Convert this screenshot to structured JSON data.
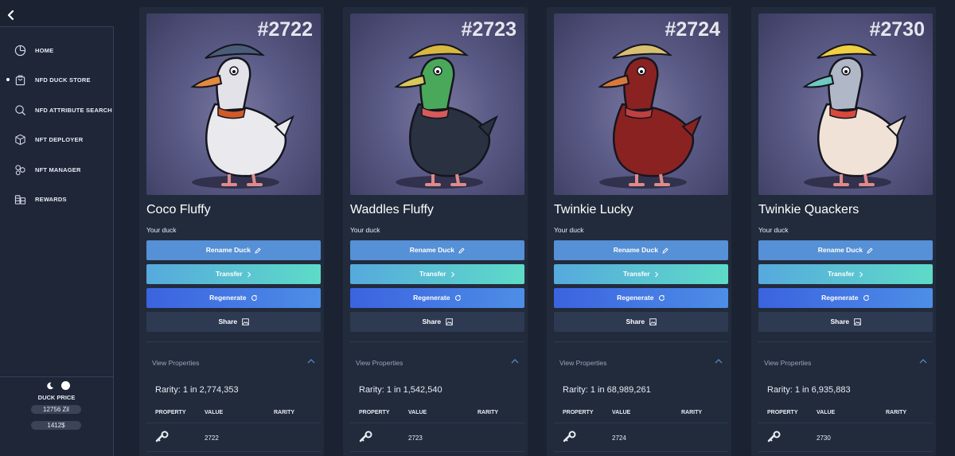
{
  "sidebar": {
    "nav": [
      {
        "label": "HOME",
        "icon": "pie-chart-icon",
        "active": false
      },
      {
        "label": "NFD DUCK STORE",
        "icon": "shopping-bag-icon",
        "active": true
      },
      {
        "label": "NFD ATTRIBUTE SEARCH",
        "icon": "search-icon",
        "active": false
      },
      {
        "label": "NFT DEPLOYER",
        "icon": "cube-icon",
        "active": false
      },
      {
        "label": "NFT MANAGER",
        "icon": "nodes-icon",
        "active": false
      },
      {
        "label": "REWARDS",
        "icon": "coins-icon",
        "active": false
      }
    ],
    "duck_price_title": "DUCK PRICE",
    "price_zil": "12756 Zil",
    "price_usd": "1412$"
  },
  "cards": [
    {
      "number": "#2722",
      "name": "Coco Fluffy",
      "subtitle": "Your duck",
      "rename": "Rename Duck",
      "transfer": "Transfer",
      "regenerate": "Regenerate",
      "share": "Share",
      "view_properties": "View Properties",
      "rarity": "Rarity: 1 in 2,774,353",
      "headers": [
        "PROPERTY",
        "VALUE",
        "RARITY"
      ],
      "row_value": "2722",
      "colors": {
        "body": "#e9e9ee",
        "head": "#e2e2e8",
        "beak": "#e38a3f",
        "hat": "#4a5d78",
        "accent": "#d05a2a"
      }
    },
    {
      "number": "#2723",
      "name": "Waddles Fluffy",
      "subtitle": "Your duck",
      "rename": "Rename Duck",
      "transfer": "Transfer",
      "regenerate": "Regenerate",
      "share": "Share",
      "view_properties": "View Properties",
      "rarity": "Rarity: 1 in 1,542,540",
      "headers": [
        "PROPERTY",
        "VALUE",
        "RARITY"
      ],
      "row_value": "2723",
      "colors": {
        "body": "#2a3140",
        "head": "#4aa85a",
        "beak": "#d8c85a",
        "hat": "#d8b840",
        "accent": "#d85a5a"
      }
    },
    {
      "number": "#2724",
      "name": "Twinkie Lucky",
      "subtitle": "Your duck",
      "rename": "Rename Duck",
      "transfer": "Transfer",
      "regenerate": "Regenerate",
      "share": "Share",
      "view_properties": "View Properties",
      "rarity": "Rarity: 1 in 68,989,261",
      "headers": [
        "PROPERTY",
        "VALUE",
        "RARITY"
      ],
      "row_value": "2724",
      "colors": {
        "body": "#8a2222",
        "head": "#8a2222",
        "beak": "#d87a3a",
        "hat": "#d8c070",
        "accent": "#c04040"
      }
    },
    {
      "number": "#2730",
      "name": "Twinkie Quackers",
      "subtitle": "Your duck",
      "rename": "Rename Duck",
      "transfer": "Transfer",
      "regenerate": "Regenerate",
      "share": "Share",
      "view_properties": "View Properties",
      "rarity": "Rarity: 1 in 6,935,883",
      "headers": [
        "PROPERTY",
        "VALUE",
        "RARITY"
      ],
      "row_value": "2730",
      "colors": {
        "body": "#f0e2d6",
        "head": "#b0b8c8",
        "beak": "#70c8c0",
        "hat": "#f0d040",
        "accent": "#d84a3a"
      }
    }
  ]
}
